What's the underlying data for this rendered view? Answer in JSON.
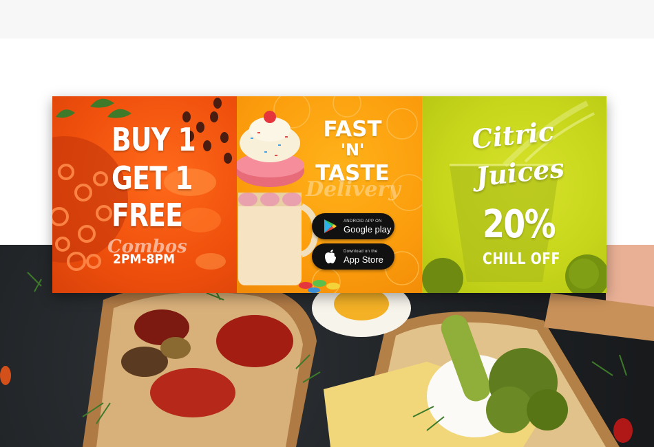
{
  "banner": {
    "panel1": {
      "line1": "BUY 1",
      "line2": "GET 1",
      "line3": "FREE",
      "script": "Combos",
      "time": "2PM-8PM",
      "color": "#ef4f0c"
    },
    "panel2": {
      "line1": "FAST",
      "line2": "'N'",
      "line3": "TASTE",
      "script": "Delivery",
      "google_play": {
        "small": "ANDROID APP ON",
        "large": "Google play"
      },
      "app_store": {
        "small": "Download on the",
        "large": "App Store"
      },
      "color": "#fb9c0c"
    },
    "panel3": {
      "line1": "Citric",
      "line2": "Juices",
      "percent": "20%",
      "offer": "CHILL OFF",
      "color": "#c6d51a"
    }
  },
  "icons": [
    "google-play-icon",
    "apple-icon"
  ]
}
